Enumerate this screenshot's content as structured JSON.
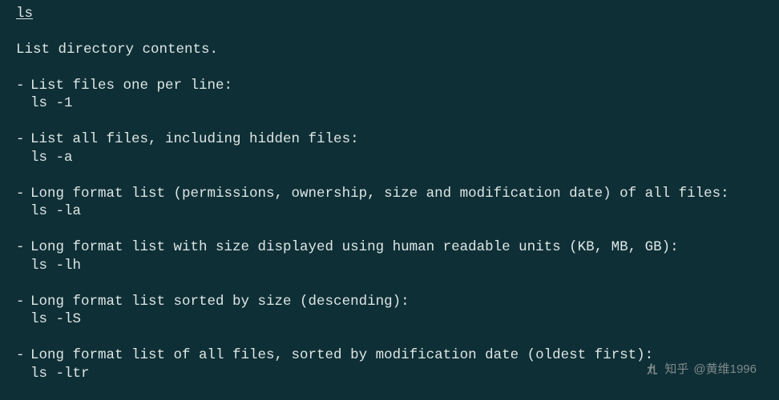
{
  "command": "ls",
  "summary": "List directory contents.",
  "items": [
    {
      "desc": "List files one per line:",
      "cmd": "ls -1"
    },
    {
      "desc": "List all files, including hidden files:",
      "cmd": "ls -a"
    },
    {
      "desc": "Long format list (permissions, ownership, size and modification date) of all files:",
      "cmd": "ls -la"
    },
    {
      "desc": "Long format list with size displayed using human readable units (KB, MB, GB):",
      "cmd": "ls -lh"
    },
    {
      "desc": "Long format list sorted by size (descending):",
      "cmd": "ls -lS"
    },
    {
      "desc": "Long format list of all files, sorted by modification date (oldest first):",
      "cmd": "ls -ltr"
    }
  ],
  "watermark": {
    "site": "知乎",
    "user": "@黄维1996"
  }
}
